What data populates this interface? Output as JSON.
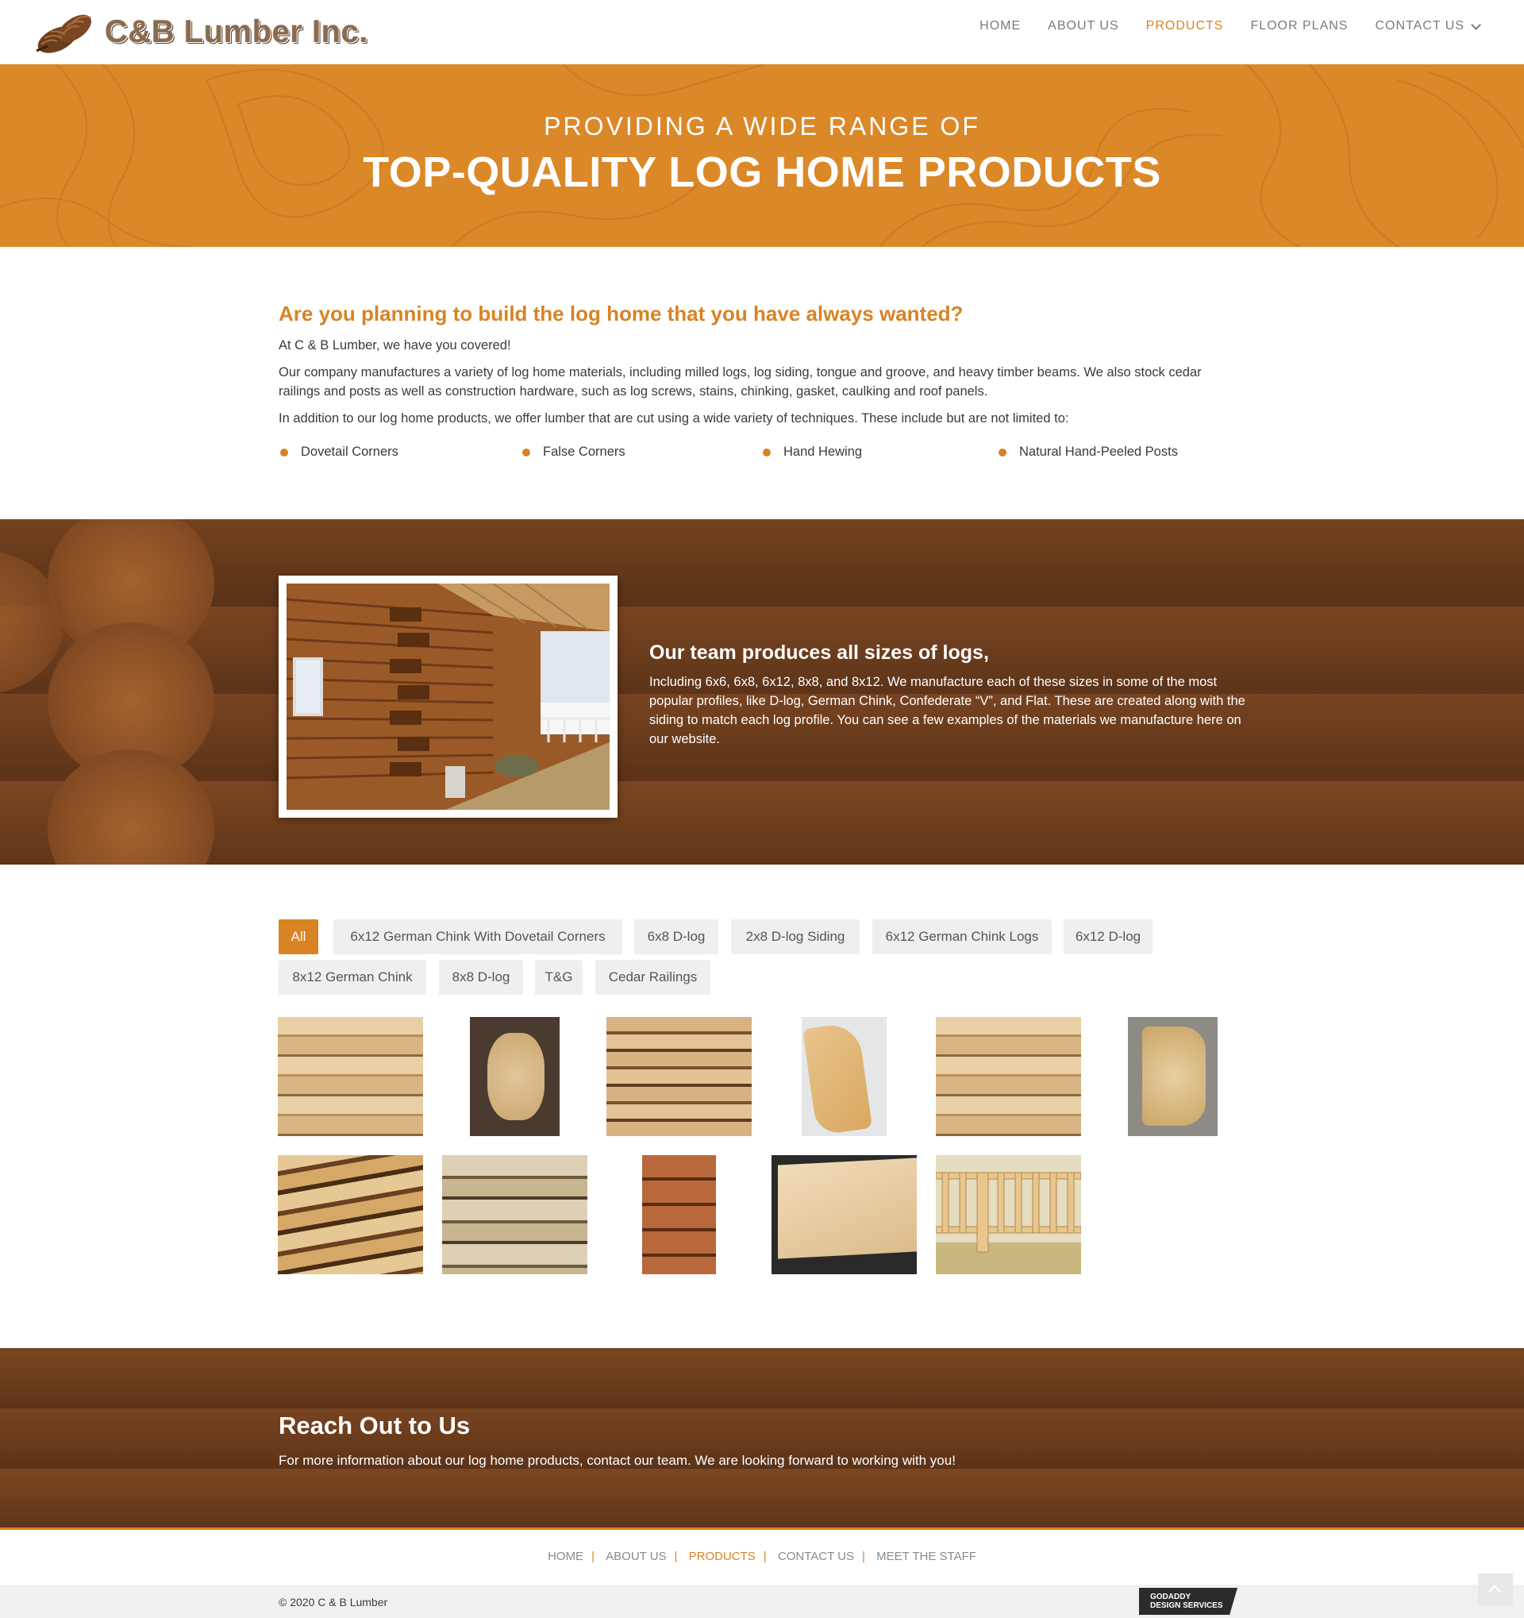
{
  "brand": {
    "name": "C&B Lumber Inc."
  },
  "nav": {
    "items": [
      {
        "label": "HOME"
      },
      {
        "label": "ABOUT US"
      },
      {
        "label": "PRODUCTS"
      },
      {
        "label": "FLOOR PLANS"
      },
      {
        "label": "CONTACT US"
      }
    ],
    "active": "PRODUCTS"
  },
  "hero": {
    "subtitle": "PROVIDING A WIDE RANGE OF",
    "title": "TOP-QUALITY LOG HOME PRODUCTS"
  },
  "intro": {
    "heading": "Are you planning to build the log home that you have always wanted?",
    "p1": "At C & B Lumber, we have you covered!",
    "p2": "Our company manufactures a variety of log home materials, including milled logs, log siding, tongue and groove, and heavy timber beams. We also stock cedar railings and posts as well as construction hardware, such as log screws, stains, chinking, gasket, caulking and roof panels.",
    "p3": "In addition to our log home products, we offer lumber that are cut using a wide variety of techniques. These include but are not limited to:",
    "bullets": [
      "Dovetail Corners",
      "False Corners",
      "Hand Hewing",
      "Natural Hand-Peeled Posts"
    ]
  },
  "team": {
    "heading": "Our team produces all sizes of logs,",
    "body": "Including 6x6, 6x8, 6x12, 8x8, and 8x12. We manufacture each of these sizes in some of the most popular profiles, like D-log, German Chink, Confederate “V”, and Flat. These are created along with the siding to match each log profile. You can see a few examples of the materials we manufacture here on our website."
  },
  "filters": {
    "items": [
      "All",
      "6x12 German Chink With Dovetail Corners",
      "6x8 D-log",
      "2x8 D-log Siding",
      "6x12 German Chink Logs",
      "6x12 D-log",
      "8x12 German Chink",
      "8x8 D-log",
      "T&G",
      "Cedar Railings"
    ],
    "active": "All"
  },
  "reach": {
    "heading": "Reach Out to Us",
    "body": "For more information about our log home products, contact our team. We are looking forward to working with you!"
  },
  "footer": {
    "links": [
      "HOME",
      "ABOUT US",
      "PRODUCTS",
      "CONTACT US",
      "MEET THE STAFF"
    ],
    "active": "PRODUCTS",
    "copyright": "© 2020 C & B Lumber",
    "badge_line1": "GODADDY",
    "badge_line2": "DESIGN SERVICES"
  },
  "colors": {
    "accent": "#d98324",
    "wood": "#6a3c1f",
    "hero": "#db8828"
  }
}
